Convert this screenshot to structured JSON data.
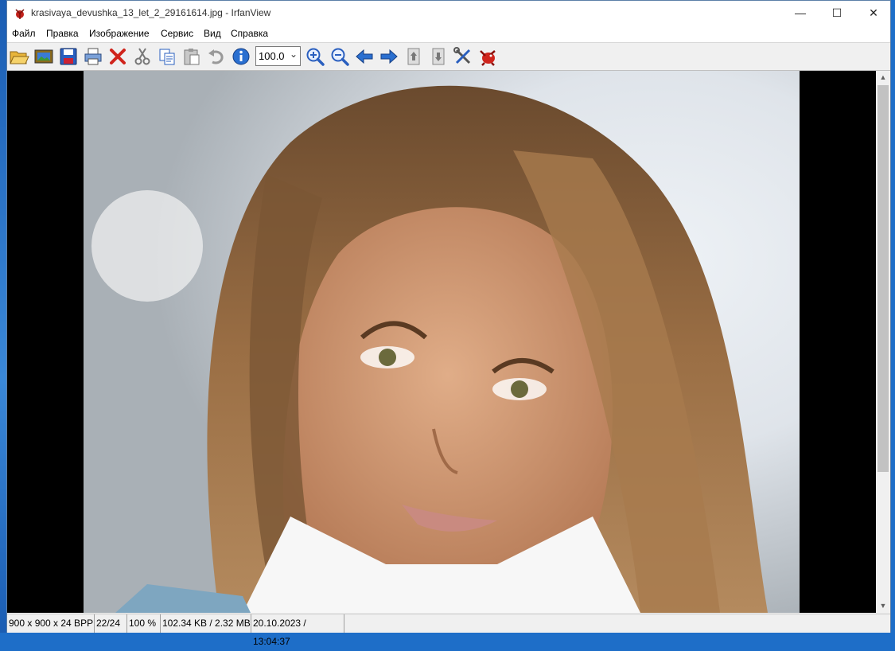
{
  "window": {
    "title": "krasivaya_devushka_13_let_2_29161614.jpg - IrfanView",
    "minimize_glyph": "—",
    "maximize_glyph": "☐",
    "close_glyph": "✕"
  },
  "menu": [
    "Файл",
    "Правка",
    "Изображение",
    "Сервис",
    "Вид",
    "Справка"
  ],
  "toolbar": {
    "buttons": [
      "open-folder-icon",
      "slideshow-icon",
      "save-icon",
      "print-icon",
      "delete-icon",
      "cut-icon",
      "copy-icon",
      "paste-icon",
      "undo-icon",
      "info-icon",
      "zoom-in-icon",
      "zoom-out-icon",
      "previous-arrow-icon",
      "next-arrow-icon",
      "page-up-icon",
      "page-down-icon",
      "settings-icon",
      "irfanview-logo-icon"
    ],
    "zoom_value": "100.0",
    "dropdown_glyph": "⌄"
  },
  "scrollbar": {
    "up_glyph": "▲",
    "down_glyph": "▼"
  },
  "status": {
    "dimensions": "900 x 900 x 24 BPP",
    "index": "22/24",
    "zoom": "100 %",
    "size": "102.34 KB / 2.32 MB",
    "datetime": "20.10.2023 / 13:04:37"
  },
  "colors": {
    "accent_blue": "#2a5fbf",
    "delete_red": "#d0241c",
    "folder_yellow": "#e8b53a"
  }
}
